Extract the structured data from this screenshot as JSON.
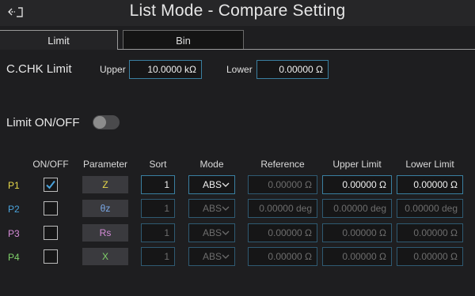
{
  "header": {
    "title": "List Mode - Compare Setting",
    "back_icon": "back-arrow-icon"
  },
  "tabs": [
    {
      "label": "Limit",
      "active": true
    },
    {
      "label": "Bin",
      "active": false
    }
  ],
  "cchk": {
    "label": "C.CHK Limit",
    "upper_label": "Upper",
    "upper_value": "10.0000 kΩ",
    "lower_label": "Lower",
    "lower_value": "0.00000 Ω"
  },
  "limit_toggle": {
    "label": "Limit ON/OFF",
    "on": false
  },
  "table": {
    "headers": {
      "onoff": "ON/OFF",
      "parameter": "Parameter",
      "sort": "Sort",
      "mode": "Mode",
      "reference": "Reference",
      "upper": "Upper Limit",
      "lower": "Lower Limit"
    },
    "rows": [
      {
        "label": "P1",
        "checked": true,
        "parameter": "Z",
        "sort": "1",
        "mode": "ABS",
        "reference": "0.00000 Ω",
        "upper": "0.00000 Ω",
        "lower": "0.00000 Ω"
      },
      {
        "label": "P2",
        "checked": false,
        "parameter": "θz",
        "sort": "1",
        "mode": "ABS",
        "reference": "0.00000 deg",
        "upper": "0.00000 deg",
        "lower": "0.00000 deg"
      },
      {
        "label": "P3",
        "checked": false,
        "parameter": "Rs",
        "sort": "1",
        "mode": "ABS",
        "reference": "0.00000 Ω",
        "upper": "0.00000 Ω",
        "lower": "0.00000 Ω"
      },
      {
        "label": "P4",
        "checked": false,
        "parameter": "X",
        "sort": "1",
        "mode": "ABS",
        "reference": "0.00000 Ω",
        "upper": "0.00000 Ω",
        "lower": "0.00000 Ω"
      }
    ]
  },
  "colors": {
    "background": "#1e1e20",
    "field_border": "#3a7fa0",
    "p1": "#e7d84a",
    "p2": "#4aa3dc",
    "p3": "#d58bd8",
    "p4": "#7fd06a",
    "param_z": "#e7d84a",
    "param_thetaz": "#7aa8e6",
    "param_rs": "#d58bd8",
    "param_x": "#7fd06a",
    "check": "#4aa3dc"
  }
}
